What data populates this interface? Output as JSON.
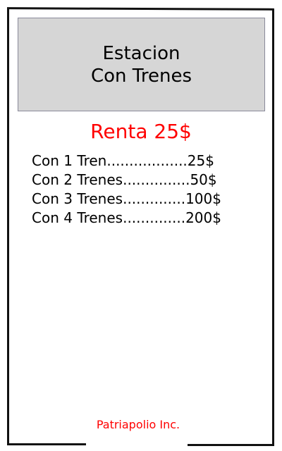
{
  "card": {
    "title_line1": "Estacion",
    "title_line2": "Con Trenes",
    "rent": "Renta 25$",
    "rent_table": [
      {
        "label": "Con 1 Tren..................25$"
      },
      {
        "label": "Con 2 Trenes...............50$"
      },
      {
        "label": "Con 3 Trenes..............100$"
      },
      {
        "label": "Con 4 Trenes..............200$"
      }
    ],
    "footer": "Patriapolio Inc.",
    "colors": {
      "accent": "#ff0000",
      "header_bg": "#d6d6d6"
    }
  }
}
